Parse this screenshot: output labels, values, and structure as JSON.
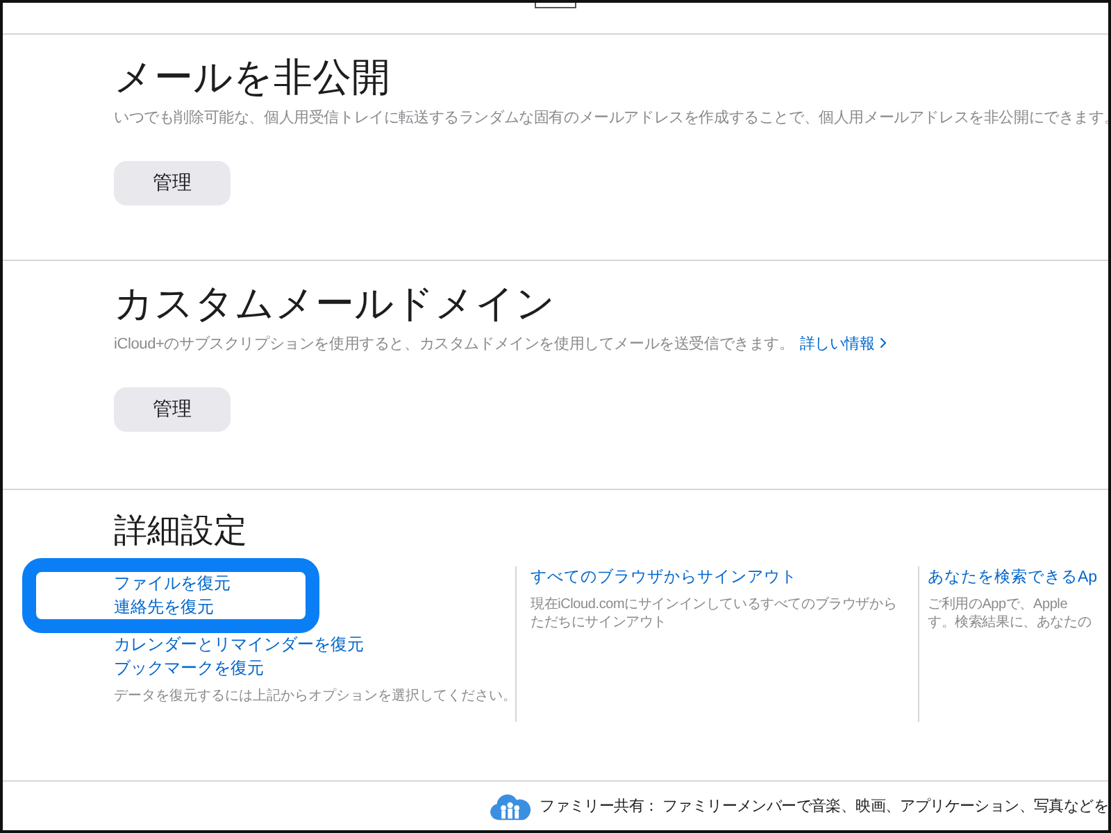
{
  "sections": [
    {
      "title": "メールを非公開",
      "description": "いつでも削除可能な、個人用受信トレイに転送するランダムな固有のメールアドレスを作成することで、個人用メールアドレスを非公開にできます。",
      "button": "管理"
    },
    {
      "title": "カスタムメールドメイン",
      "description": "iCloud+のサブスクリプションを使用すると、カスタムドメインを使用してメールを送受信できます。",
      "link": "詳しい情報",
      "button": "管理"
    }
  ],
  "advanced": {
    "title": "詳細設定",
    "restore_links": [
      {
        "label": "ファイルを復元",
        "highlighted": true
      },
      {
        "label": "連絡先を復元",
        "highlighted": true
      },
      {
        "label": "カレンダーとリマインダーを復元",
        "highlighted": false
      },
      {
        "label": "ブックマークを復元",
        "highlighted": false
      }
    ],
    "restore_note": "データを復元するには上記からオプションを選択してください。",
    "columns": [
      {
        "link": "すべてのブラウザからサインアウト",
        "description_lines": [
          "現在iCloud.comにサインインしているすべてのブラウザから",
          "ただちにサインアウト"
        ]
      },
      {
        "link": "あなたを検索できるAp",
        "description_lines": [
          "ご利用のAppで、Apple",
          "す。検索結果に、あなたの"
        ]
      }
    ]
  },
  "footer": {
    "text": "ファミリー共有： ファミリーメンバーで音楽、映画、アプリケーション、写真などを"
  }
}
